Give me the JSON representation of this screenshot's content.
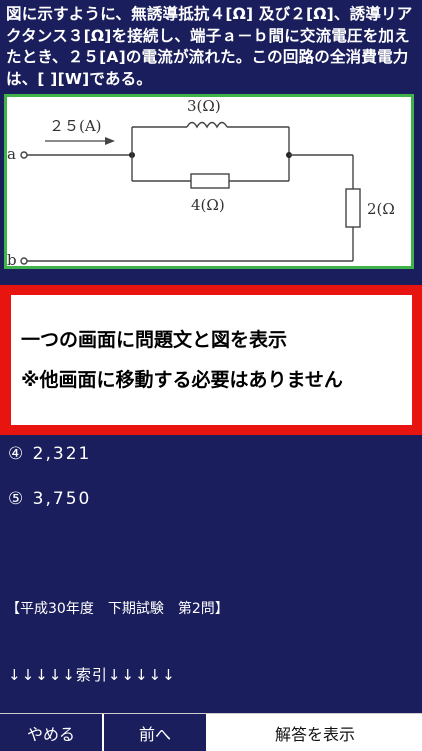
{
  "question": {
    "text": "図に示すように、無誘導抵抗４[Ω] 及び２[Ω]、誘導リアクタンス３[Ω]を接続し、端子ａ－ｂ間に交流電圧を加えたとき、２５[A]の電流が流れた。この回路の全消費電力は、[ ][W]である。"
  },
  "diagram": {
    "current_label": "２５(A)",
    "terminal_a": "a",
    "terminal_b": "b",
    "inductor_label": "3(Ω)",
    "resistor_parallel_label": "4(Ω)",
    "resistor_series_label": "2(Ω"
  },
  "overlay": {
    "line1": "一つの画面に問題文と図を表示",
    "line2": "※他画面に移動する必要はありません"
  },
  "answers": [
    {
      "marker": "④",
      "value": "2,321"
    },
    {
      "marker": "⑤",
      "value": "3,750"
    }
  ],
  "session": "【平成30年度　下期試験　第2問】",
  "index": "↓↓↓↓↓索引↓↓↓↓↓",
  "buttons": {
    "quit": "やめる",
    "prev": "前へ",
    "show_answer": "解答を表示"
  }
}
